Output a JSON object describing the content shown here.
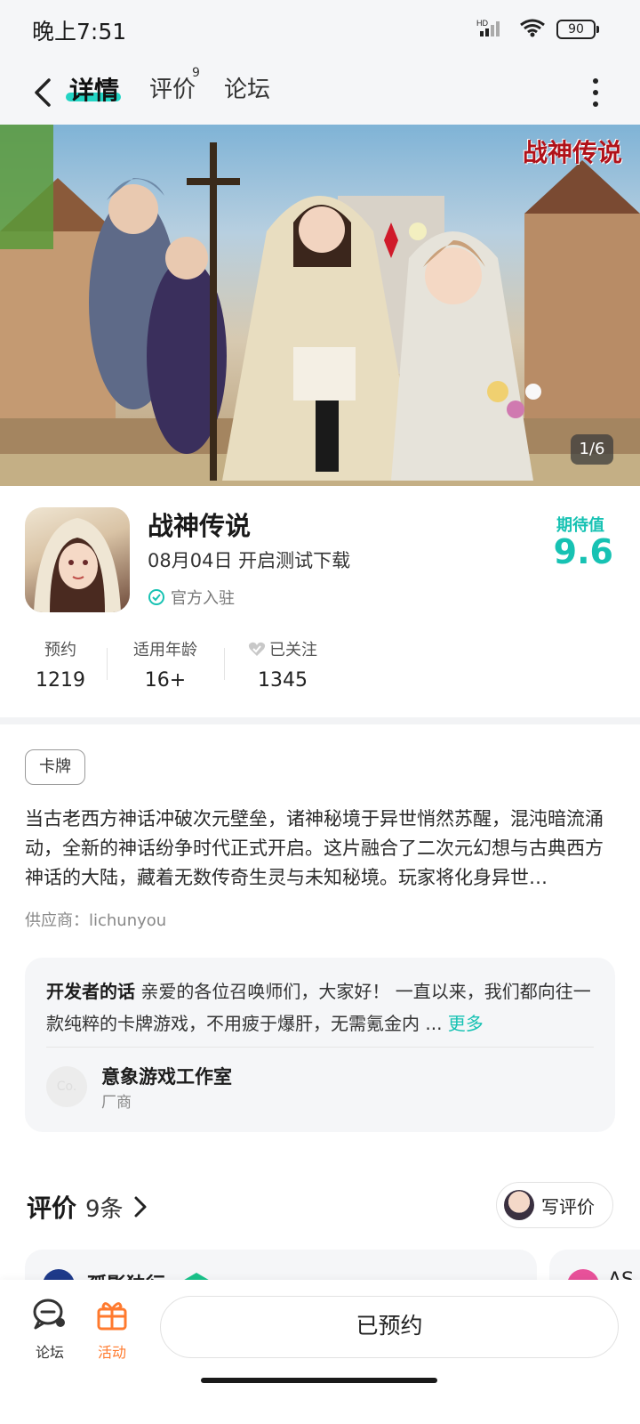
{
  "status": {
    "time": "晚上7:51",
    "network": "HD",
    "battery": "90"
  },
  "nav": {
    "tab_detail": "详情",
    "tab_review": "评价",
    "tab_review_sup": "9",
    "tab_forum": "论坛"
  },
  "banner": {
    "pager": "1/6",
    "logo": "战神传说"
  },
  "game": {
    "title": "战神传说",
    "date": "08月04日 开启测试下载",
    "official": "官方入驻",
    "expect_label": "期待值",
    "expect_score": "9.6"
  },
  "stats": [
    {
      "label": "预约",
      "value": "1219"
    },
    {
      "label": "适用年龄",
      "value": "16+"
    },
    {
      "label": "已关注",
      "value": "1345"
    }
  ],
  "tag": "卡牌",
  "description": "当古老西方神话冲破次元壁垒，诸神秘境于异世悄然苏醒，混沌暗流涌动，全新的神话纷争时代正式开启。这片融合了二次元幻想与古典西方神话的大陆，藏着无数传奇生灵与未知秘境。玩家将化身异世…",
  "supplier": "供应商：lichunyou",
  "developer": {
    "heading": "开发者的话",
    "text": "亲爱的各位召唤师们，大家好！ 一直以来，我们都向往一款纯粹的卡牌游戏，不用疲于爆肝，无需氪金内 ...",
    "more": "更多",
    "avatar_text": "Co.",
    "studio": "意象游戏工作室",
    "role": "厂商"
  },
  "reviews": {
    "title": "评价",
    "count": "9条",
    "write_label": "写评价",
    "card1_name": "孤影独行",
    "card2_name": "AS"
  },
  "bottom": {
    "forum_label": "论坛",
    "activity_label": "活动",
    "reserved_label": "已预约"
  },
  "colors": {
    "accent": "#17c2b3",
    "activity": "#ff7a2e"
  }
}
